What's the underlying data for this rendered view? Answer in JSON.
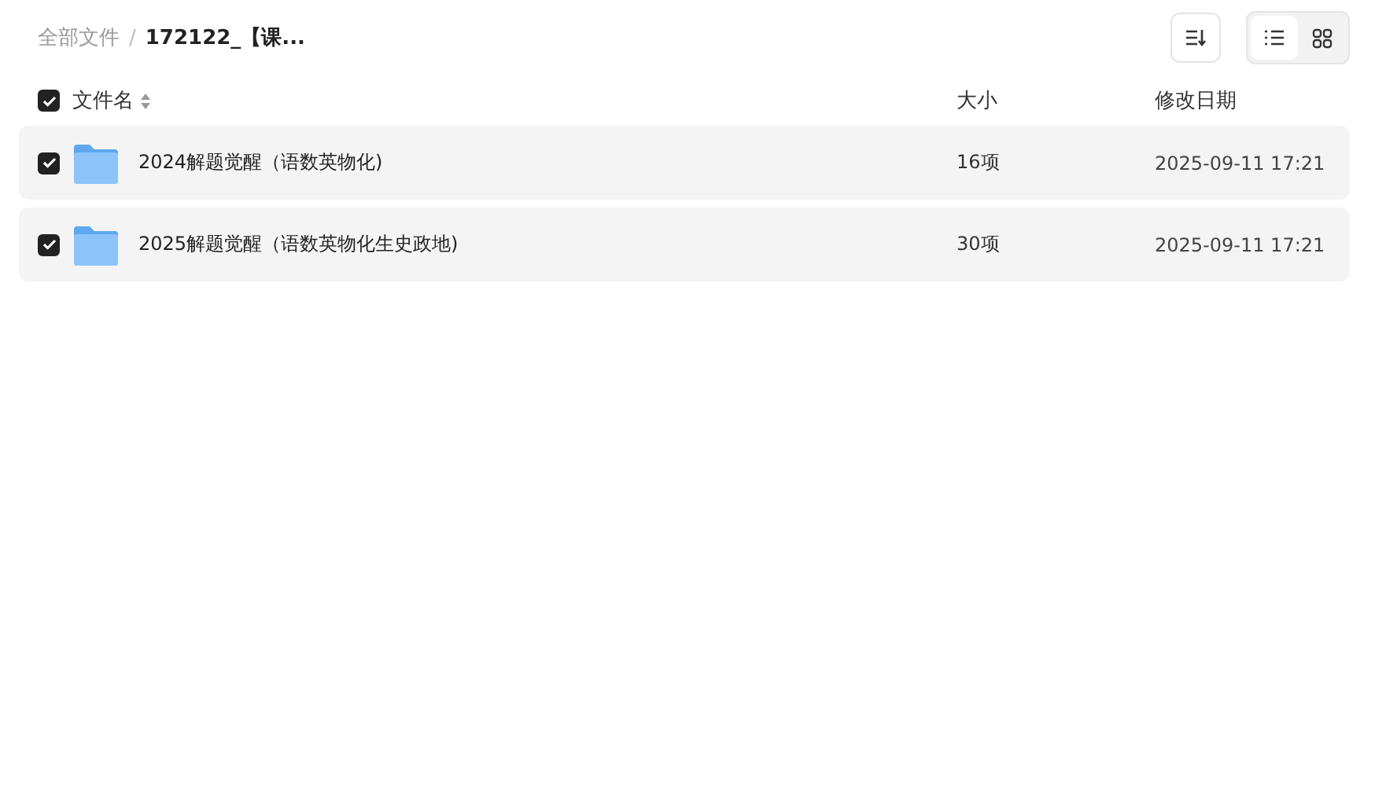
{
  "breadcrumb_separator": "/",
  "breadcrumb": [
    {
      "label": "全部文件",
      "current": false
    },
    {
      "label": "172122_【课...",
      "current": true
    }
  ],
  "view_modes": [
    {
      "kind": "list",
      "selected": true
    },
    {
      "kind": "grid",
      "selected": false
    }
  ],
  "header": {
    "checked": true,
    "columns": [
      "文件名",
      "大小",
      "修改日期"
    ]
  },
  "rows": [
    {
      "checked": true,
      "name": "2024解题觉醒（语数英物化)",
      "size": "16项",
      "modified": "2025-09-11 17:21"
    },
    {
      "checked": true,
      "name": "2025解题觉醒（语数英物化生史政地)",
      "size": "30项",
      "modified": "2025-09-11 17:21"
    }
  ]
}
